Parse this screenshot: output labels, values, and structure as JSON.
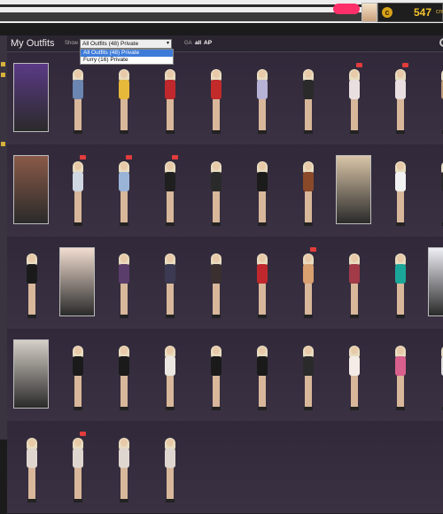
{
  "topbar": {
    "credits": "547",
    "credits_suffix": "credi",
    "coin_symbol": "c"
  },
  "panel": {
    "title": "My Outfits",
    "show_label": "Show",
    "select_value": "All Outfits (48) Private",
    "dropdown_options": [
      "All Outfits (48) Private",
      "Furry (16) Private"
    ],
    "ga_label": "GA",
    "filter_all": "all",
    "filter_ap": "AP"
  },
  "colors": {
    "accent": "#d6a219",
    "selected_option": "#3d7bd9",
    "notification": "#ff2f6a",
    "ap_badge": "#e23c3c"
  }
}
